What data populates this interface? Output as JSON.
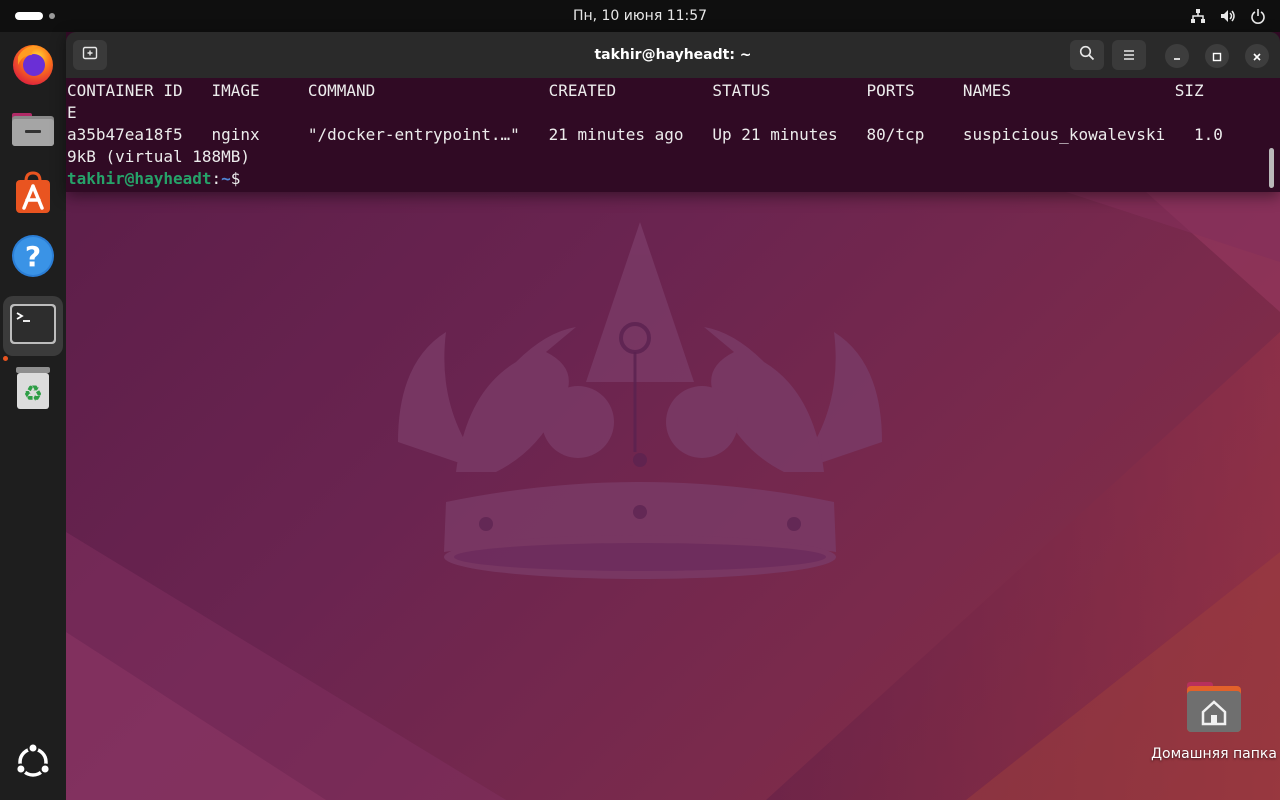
{
  "topbar": {
    "clock": "Пн, 10 июня  11:57",
    "icons": [
      "network-icon",
      "volume-icon",
      "power-icon"
    ]
  },
  "dock": {
    "apps": [
      "firefox-icon",
      "files-icon",
      "app-center-icon",
      "help-icon",
      "terminal-icon",
      "trash-icon"
    ],
    "show_apps": "show-apps-icon"
  },
  "terminal": {
    "title": "takhir@hayheadt: ~",
    "lines": [
      "CONTAINER ID   IMAGE     COMMAND                  CREATED          STATUS          PORTS     NAMES                 SIZ",
      "E",
      "a35b47ea18f5   nginx     \"/docker-entrypoint.…\"   21 minutes ago   Up 21 minutes   80/tcp    suspicious_kowalevski   1.0",
      "9kB (virtual 188MB)"
    ],
    "prompt": {
      "user_host": "takhir@hayheadt",
      "separator": ":",
      "path": "~",
      "symbol": "$"
    }
  },
  "desktop": {
    "home_folder_label": "Домашняя папка"
  },
  "colors": {
    "terminal_bg": "#300a24",
    "prompt_user": "#26a269",
    "prompt_path": "#4f86d7",
    "accent": "#e95420"
  }
}
